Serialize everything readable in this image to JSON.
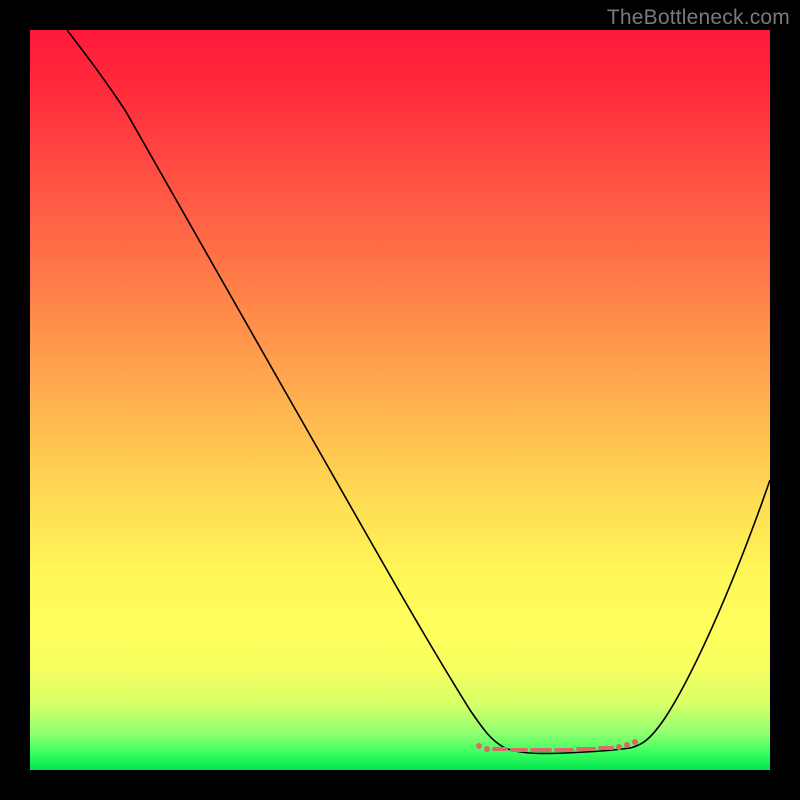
{
  "watermark": "TheBottleneck.com",
  "chart_data": {
    "type": "line",
    "title": "",
    "xlabel": "",
    "ylabel": "",
    "xlim": [
      0,
      100
    ],
    "ylim": [
      0,
      100
    ],
    "grid": false,
    "legend": false,
    "series": [
      {
        "name": "curve",
        "x": [
          5,
          10,
          15,
          20,
          25,
          30,
          35,
          40,
          45,
          50,
          55,
          60,
          63,
          66,
          70,
          75,
          80,
          82,
          85,
          90,
          95,
          100
        ],
        "y": [
          100,
          95,
          89,
          80,
          71,
          62,
          53,
          44,
          35,
          26,
          18,
          10,
          6,
          3.5,
          2,
          1.5,
          2,
          2.5,
          4,
          12,
          25,
          40
        ]
      },
      {
        "name": "bottom-highlight",
        "x": [
          63,
          66,
          70,
          75,
          80,
          82
        ],
        "y": [
          3.5,
          3,
          2.5,
          2.5,
          3,
          3.3
        ]
      }
    ],
    "colors": {
      "curve": "#000000",
      "highlight": "#d96a6a",
      "gradient_top": "#ff1a3a",
      "gradient_mid": "#ffe054",
      "gradient_bottom": "#00e850"
    }
  }
}
